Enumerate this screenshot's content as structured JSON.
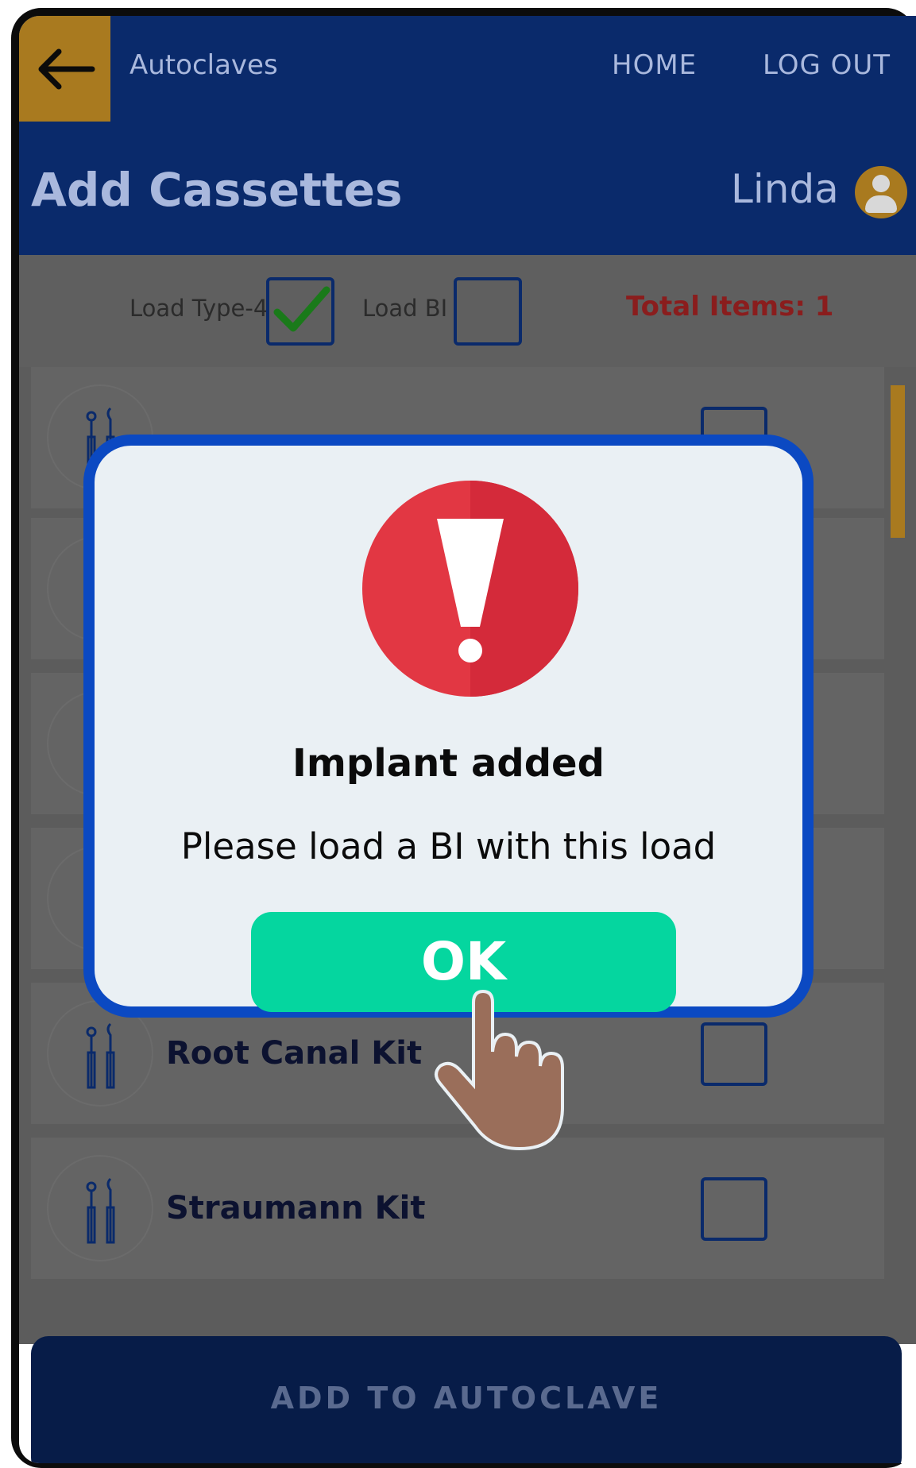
{
  "topbar": {
    "back_icon": "arrow-left-icon",
    "title": "Autoclaves",
    "home": "HOME",
    "logout": "LOG OUT"
  },
  "header": {
    "title": "Add Cassettes",
    "user_name": "Linda",
    "avatar_icon": "user-icon"
  },
  "options": {
    "load_type_label": "Load Type-4",
    "load_type_checked": true,
    "load_bi_label": "Load BI",
    "load_bi_checked": false,
    "total_items": "Total Items: 1"
  },
  "list": {
    "items": [
      {
        "label": "",
        "checked": false
      },
      {
        "label": "",
        "checked": false
      },
      {
        "label": "",
        "checked": false
      },
      {
        "label": "",
        "control": "add"
      },
      {
        "label": "Root Canal Kit",
        "checked": false
      },
      {
        "label": "Straumann Kit",
        "checked": false
      }
    ]
  },
  "footer": {
    "add_button": "ADD TO AUTOCLAVE"
  },
  "modal": {
    "icon": "exclamation-alert-icon",
    "title": "Implant added",
    "message": "Please load a BI with this load",
    "ok_button": "OK",
    "pointer_icon": "tap-hand-icon"
  },
  "colors": {
    "nav_blue": "#0a2a6b",
    "accent_gold": "#a97a1f",
    "modal_border": "#0b49c2",
    "ok_green": "#05d69f",
    "alert_red": "#d62a3a",
    "total_red": "#8a1d1d"
  }
}
